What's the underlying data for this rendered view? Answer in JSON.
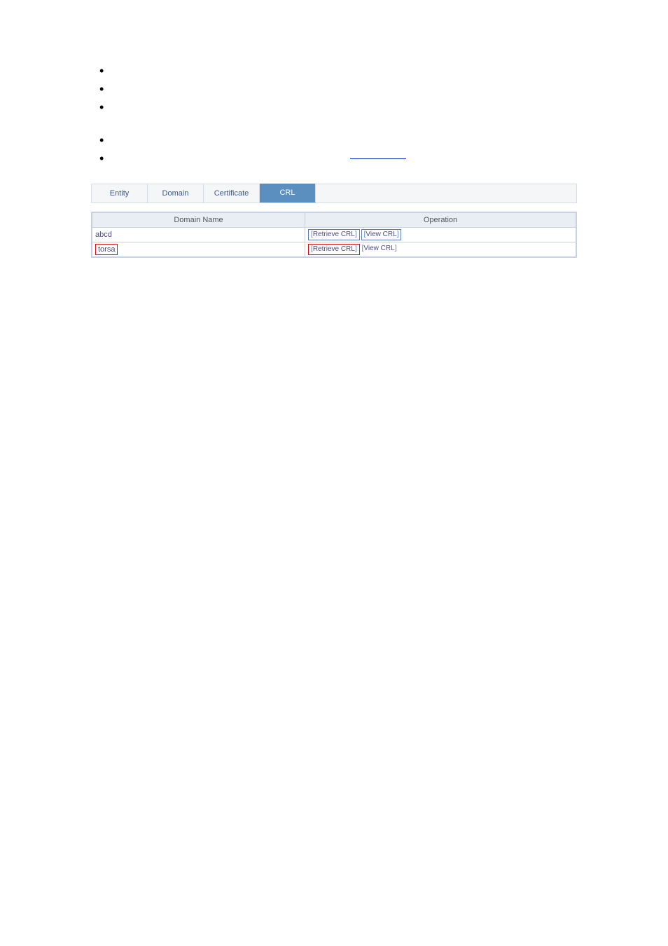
{
  "bullets_a": [
    "",
    "",
    ""
  ],
  "bullets_b": [
    "",
    ""
  ],
  "tabs": [
    {
      "label": "Entity",
      "active": false
    },
    {
      "label": "Domain",
      "active": false
    },
    {
      "label": "Certificate",
      "active": false
    },
    {
      "label": "CRL",
      "active": true
    }
  ],
  "table": {
    "headers": [
      "Domain Name",
      "Operation"
    ],
    "rows": [
      {
        "name": "abcd",
        "name_boxed": false,
        "ops": [
          {
            "label": "Retrieve CRL",
            "boxed": true,
            "red": false
          },
          {
            "label": "View CRL",
            "boxed": true,
            "red": false
          }
        ]
      },
      {
        "name": "torsa",
        "name_boxed": true,
        "ops": [
          {
            "label": "Retrieve CRL",
            "boxed": true,
            "red": true
          },
          {
            "label": "View CRL",
            "boxed": false,
            "red": false
          }
        ]
      }
    ]
  }
}
